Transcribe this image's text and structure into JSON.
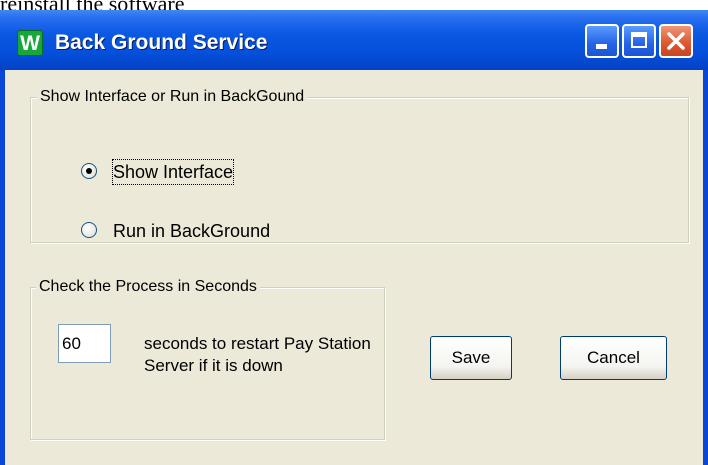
{
  "background_caption": "reinstall the software",
  "window": {
    "title": "Back Ground Service",
    "icon_letter": "W",
    "icon_name": "app-w-icon",
    "controls": {
      "minimize_icon": "minimize-icon",
      "maximize_icon": "maximize-icon",
      "close_icon": "close-icon"
    }
  },
  "mode_group": {
    "legend": "Show Interface or Run in BackGound",
    "options": [
      {
        "label": "Show Interface",
        "selected": true
      },
      {
        "label": "Run in BackGround",
        "selected": false
      }
    ]
  },
  "process_group": {
    "legend": "Check the Process in Seconds",
    "seconds_value": "60",
    "description": "seconds to restart Pay Station Server if it is down"
  },
  "buttons": {
    "save_label": "Save",
    "cancel_label": "Cancel"
  },
  "colors": {
    "titlebar": "#0550dc",
    "client_bg": "#ece9d8",
    "close_button": "#dc5a33"
  }
}
